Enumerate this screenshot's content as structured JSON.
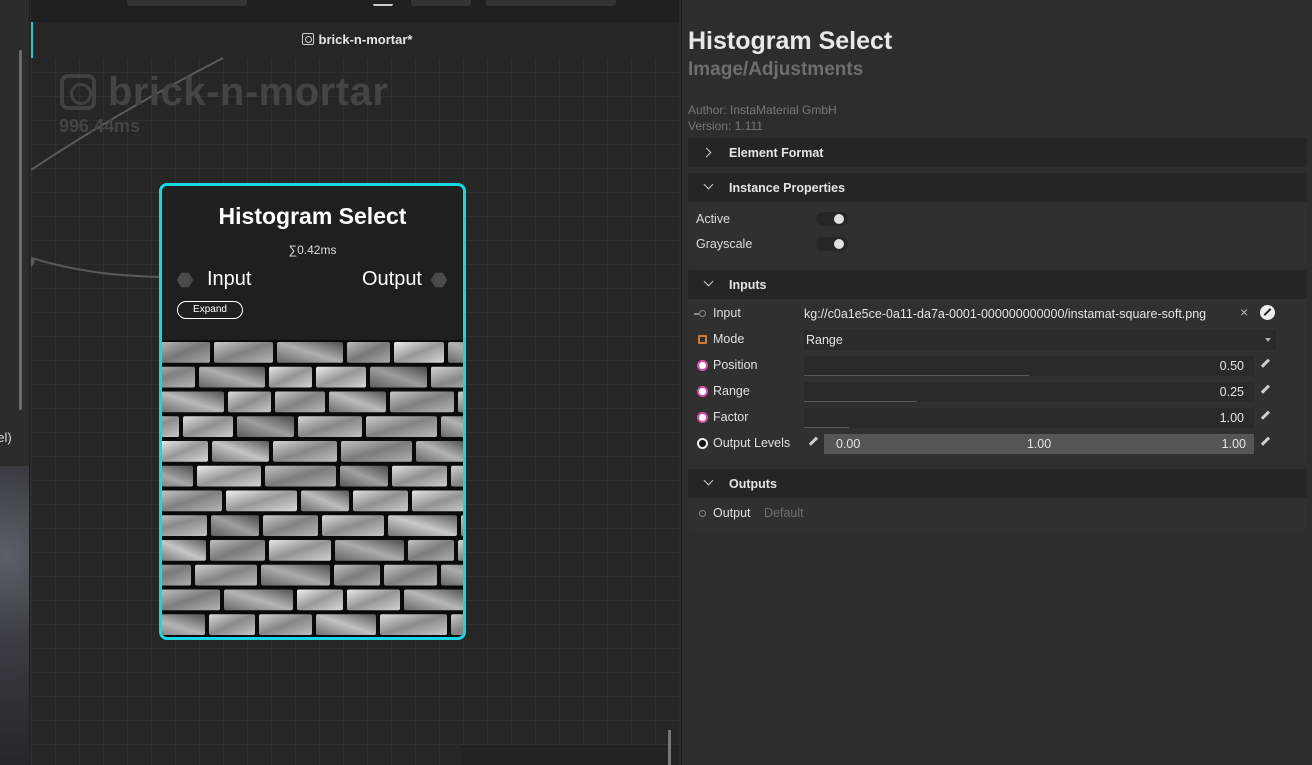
{
  "left_panel": {
    "partial_label": "nel)"
  },
  "graph": {
    "tab_title": "brick-n-mortar*",
    "watermark_title": "brick-n-mortar",
    "watermark_time": "996.44ms",
    "node": {
      "title": "Histogram Select",
      "time": "∑0.42ms",
      "input_label": "Input",
      "output_label": "Output",
      "expand_label": "Expand"
    }
  },
  "panel": {
    "title": "Histogram Select",
    "subtitle": "Image/Adjustments",
    "author": "Author: InstaMaterial GmbH",
    "version": "Version: 1.111",
    "sections": {
      "element_format": {
        "label": "Element Format"
      },
      "instance_properties": {
        "label": "Instance Properties",
        "active_label": "Active",
        "grayscale_label": "Grayscale"
      },
      "inputs": {
        "label": "Inputs",
        "input": {
          "label": "Input",
          "value": "kg://c0a1e5ce-0a11-da7a-0001-000000000000/instamat-square-soft.png"
        },
        "mode": {
          "label": "Mode",
          "value": "Range"
        },
        "position": {
          "label": "Position",
          "value": "0.50",
          "fraction": 0.5
        },
        "range": {
          "label": "Range",
          "value": "0.25",
          "fraction": 0.25
        },
        "factor": {
          "label": "Factor",
          "value": "1.00",
          "fraction": 0.1
        },
        "output_levels": {
          "label": "Output Levels",
          "low": "0.00",
          "mid": "1.00",
          "high": "1.00"
        }
      },
      "outputs": {
        "label": "Outputs",
        "output": {
          "label": "Output",
          "value": "Default"
        }
      }
    }
  },
  "colors": {
    "node_border": "#19d6e3",
    "accent_pink": "#d84fa6",
    "mode_orange": "#d07a3a"
  }
}
